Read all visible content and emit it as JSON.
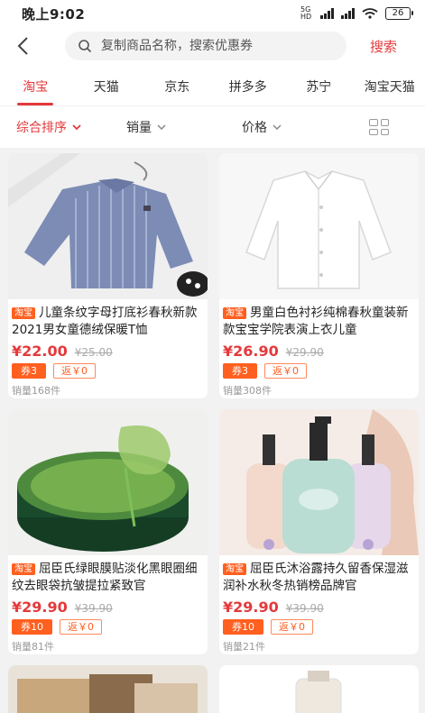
{
  "status": {
    "time": "晚上9:02",
    "network": "5G HD",
    "battery": "26"
  },
  "header": {
    "search_placeholder": "复制商品名称，搜索优惠券",
    "search_button": "搜索"
  },
  "tabs": [
    {
      "label": "淘宝",
      "active": true
    },
    {
      "label": "天猫"
    },
    {
      "label": "京东"
    },
    {
      "label": "拼多多"
    },
    {
      "label": "苏宁"
    },
    {
      "label": "淘宝天猫"
    }
  ],
  "sort": {
    "overall": "综合排序",
    "sales": "销量",
    "price": "价格",
    "layout_icon": "grid-view-icon"
  },
  "colors": {
    "accent": "#e4393c",
    "badge": "#ff5f1f"
  },
  "products": [
    {
      "platform": "淘宝",
      "title": "儿童条纹字母打底衫春秋新款2021男女童德绒保暖T恤",
      "price": "¥22.00",
      "original_price": "¥25.00",
      "coupon": "券3",
      "rebate": "返￥0",
      "sales": "销量168件"
    },
    {
      "platform": "淘宝",
      "title": "男童白色衬衫纯棉春秋童装新款宝宝学院表演上衣儿童",
      "price": "¥26.90",
      "original_price": "¥29.90",
      "coupon": "券3",
      "rebate": "返￥0",
      "sales": "销量308件"
    },
    {
      "platform": "淘宝",
      "title": "屈臣氏绿眼膜贴淡化黑眼圈细纹去眼袋抗皱提拉紧致官",
      "price": "¥29.90",
      "original_price": "¥39.90",
      "coupon": "券10",
      "rebate": "返￥0",
      "sales": "销量81件"
    },
    {
      "platform": "淘宝",
      "title": "屈臣氏沐浴露持久留香保湿滋润补水秋冬热销榜品牌官",
      "price": "¥29.90",
      "original_price": "¥39.90",
      "coupon": "券10",
      "rebate": "返￥0",
      "sales": "销量21件"
    }
  ]
}
